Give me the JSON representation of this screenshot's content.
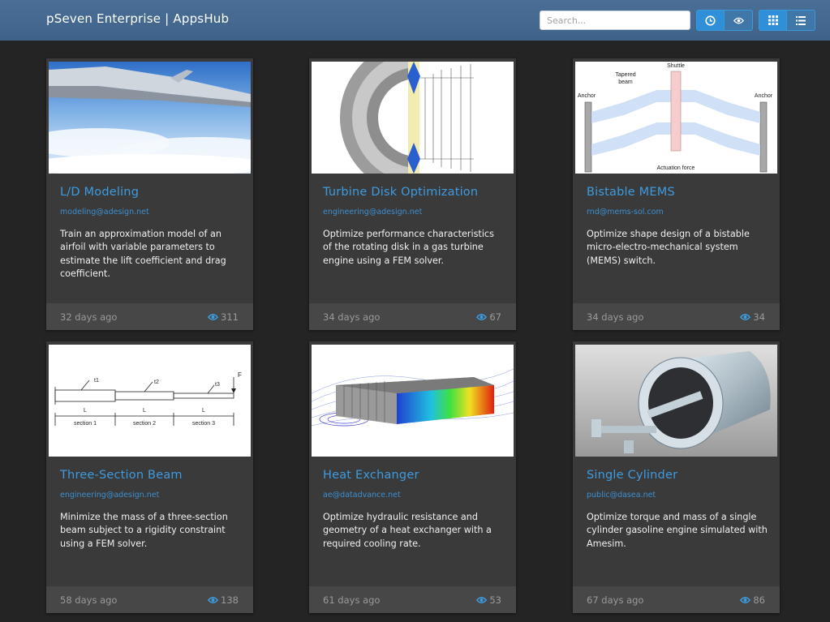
{
  "header": {
    "brand": "pSeven Enterprise | AppsHub",
    "search_placeholder": "Search...",
    "sort_buttons": [
      {
        "name": "recent",
        "icon": "clock-icon",
        "active": true
      },
      {
        "name": "popular",
        "icon": "eye-icon",
        "active": false
      }
    ],
    "view_buttons": [
      {
        "name": "grid",
        "icon": "grid-icon",
        "active": true
      },
      {
        "name": "list",
        "icon": "list-icon",
        "active": false
      }
    ]
  },
  "apps": [
    {
      "title": "L/D Modeling",
      "email": "modeling@adesign.net",
      "description": "Train an approximation model of an airfoil with variable parameters to estimate the lift coefficient and drag coefficient.",
      "age": "32 days ago",
      "views": "311",
      "thumbnail": "airplane-wing-image"
    },
    {
      "title": "Turbine Disk Optimization",
      "email": "engineering@adesign.net",
      "description": "Optimize performance characteristics of the rotating disk in a gas turbine engine using a FEM solver.",
      "age": "34 days ago",
      "views": "67",
      "thumbnail": "turbine-disk-image"
    },
    {
      "title": "Bistable MEMS",
      "email": "rnd@mems-sol.com",
      "description": "Optimize shape design of a bistable micro-electro-mechanical system (MEMS) switch.",
      "age": "34 days ago",
      "views": "34",
      "thumbnail": "mems-diagram-image",
      "thumbnail_labels": {
        "shuttle": "Shuttle",
        "tapered": "Tapered",
        "beam": "beam",
        "anchor_left": "Anchor",
        "anchor_right": "Anchor",
        "force": "Actuation force"
      }
    },
    {
      "title": "Three-Section Beam",
      "email": "engineering@adesign.net",
      "description": "Minimize the mass of a three-section beam subject to a rigidity constraint using a FEM solver.",
      "age": "58 days ago",
      "views": "138",
      "thumbnail": "beam-diagram-image",
      "thumbnail_labels": {
        "t1": "t1",
        "t2": "t2",
        "t3": "t3",
        "f": "F",
        "l1": "L",
        "l2": "L",
        "l3": "L",
        "s1": "section 1",
        "s2": "section 2",
        "s3": "section 3"
      }
    },
    {
      "title": "Heat Exchanger",
      "email": "ae@datadvance.net",
      "description": "Optimize hydraulic resistance and geometry of a heat exchanger with a required cooling rate.",
      "age": "61 days ago",
      "views": "53",
      "thumbnail": "heat-exchanger-image"
    },
    {
      "title": "Single Cylinder",
      "email": "public@dasea.net",
      "description": "Optimize torque and mass of a single cylinder gasoline engine simulated with Amesim.",
      "age": "67 days ago",
      "views": "86",
      "thumbnail": "cylinder-model-image"
    }
  ],
  "colors": {
    "navbar": "#4a6f96",
    "accent": "#3d9be0",
    "card": "#3a3a3a",
    "footer": "#474747",
    "background": "#242424"
  }
}
